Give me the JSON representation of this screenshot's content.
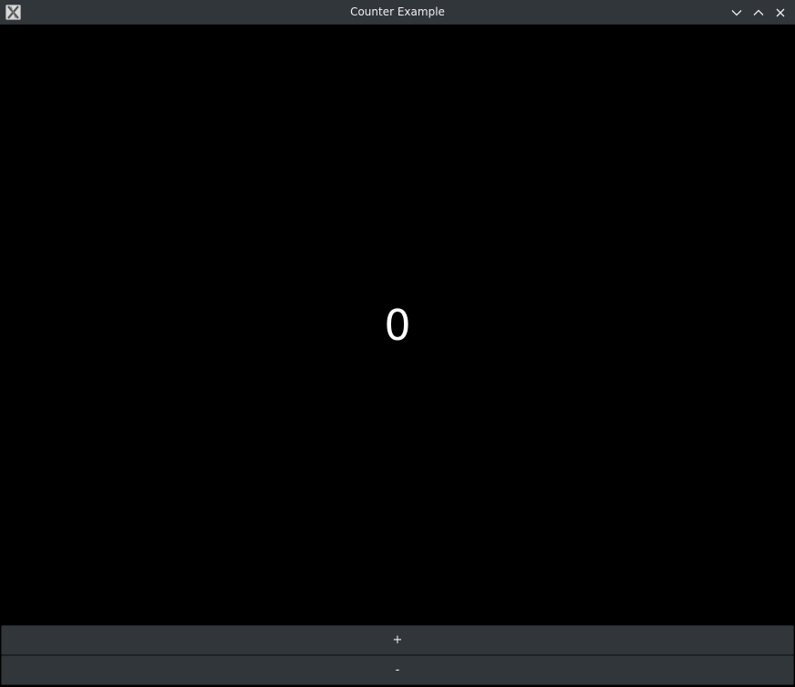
{
  "window": {
    "title": "Counter Example",
    "icon": "x-window-icon",
    "controls": {
      "minimize_icon": "chevron-down-icon",
      "maximize_icon": "chevron-up-icon",
      "close_icon": "close-icon"
    }
  },
  "counter": {
    "value": "0"
  },
  "buttons": {
    "increment_label": "+",
    "decrement_label": "-"
  },
  "colors": {
    "titlebar": "#31363b",
    "background": "#000000",
    "button": "#31363b",
    "text": "#eff0f1"
  }
}
